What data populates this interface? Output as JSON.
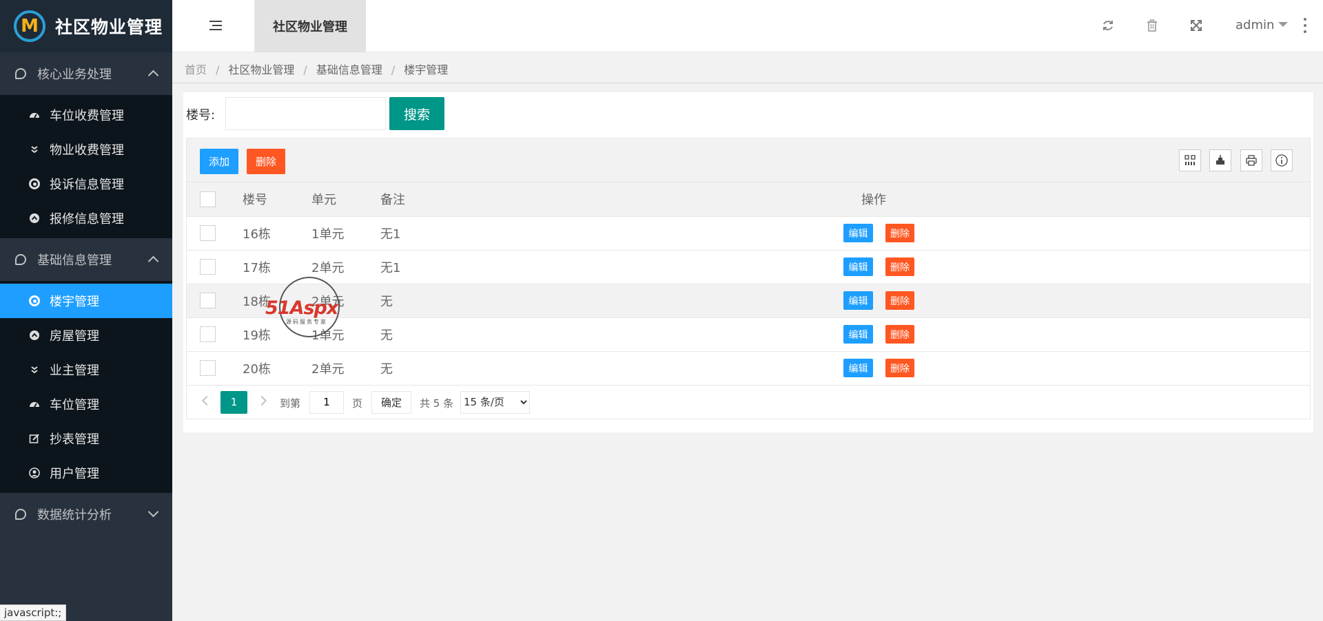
{
  "app": {
    "title": "社区物业管理"
  },
  "sidebar": {
    "groups": [
      {
        "label": "核心业务处理",
        "expanded": true,
        "items": [
          {
            "label": "车位收费管理",
            "icon": "dashboard-icon"
          },
          {
            "label": "物业收费管理",
            "icon": "double-chevron-down-icon"
          },
          {
            "label": "投诉信息管理",
            "icon": "target-icon"
          },
          {
            "label": "报修信息管理",
            "icon": "circle-up-icon"
          }
        ]
      },
      {
        "label": "基础信息管理",
        "expanded": true,
        "items": [
          {
            "label": "楼宇管理",
            "icon": "target-icon",
            "active": true
          },
          {
            "label": "房屋管理",
            "icon": "circle-up-icon"
          },
          {
            "label": "业主管理",
            "icon": "double-chevron-down-icon"
          },
          {
            "label": "车位管理",
            "icon": "dashboard-icon"
          },
          {
            "label": "抄表管理",
            "icon": "edit-icon"
          },
          {
            "label": "用户管理",
            "icon": "user-circle-icon"
          }
        ]
      },
      {
        "label": "数据统计分析",
        "expanded": false,
        "items": []
      }
    ]
  },
  "header": {
    "tab_label": "社区物业管理",
    "user": "admin"
  },
  "breadcrumb": [
    "首页",
    "社区物业管理",
    "基础信息管理",
    "楼宇管理"
  ],
  "search": {
    "label": "楼号:",
    "value": "",
    "button": "搜索"
  },
  "toolbar": {
    "add_label": "添加",
    "delete_label": "删除"
  },
  "table": {
    "columns": [
      "楼号",
      "单元",
      "备注",
      "操作"
    ],
    "rows": [
      {
        "building": "16栋",
        "unit": "1单元",
        "note": "无1"
      },
      {
        "building": "17栋",
        "unit": "2单元",
        "note": "无1"
      },
      {
        "building": "18栋",
        "unit": "2单元",
        "note": "无"
      },
      {
        "building": "19栋",
        "unit": "1单元",
        "note": "无"
      },
      {
        "building": "20栋",
        "unit": "2单元",
        "note": "无"
      }
    ],
    "row_actions": {
      "edit": "编辑",
      "delete": "删除"
    }
  },
  "pager": {
    "current_page": "1",
    "goto_prefix": "到第",
    "goto_value": "1",
    "goto_suffix": "页",
    "confirm": "确定",
    "total": "共 5 条",
    "page_size": "15 条/页"
  },
  "watermark": {
    "brand": "51Aspx",
    "tagline": "源码服务专家"
  },
  "status_bar": "javascript:;",
  "colors": {
    "sidebar_bg": "#28323f",
    "submenu_bg": "#0d151c",
    "active_blue": "#1e9fff",
    "primary_green": "#009688",
    "danger_orange": "#ff5722"
  }
}
